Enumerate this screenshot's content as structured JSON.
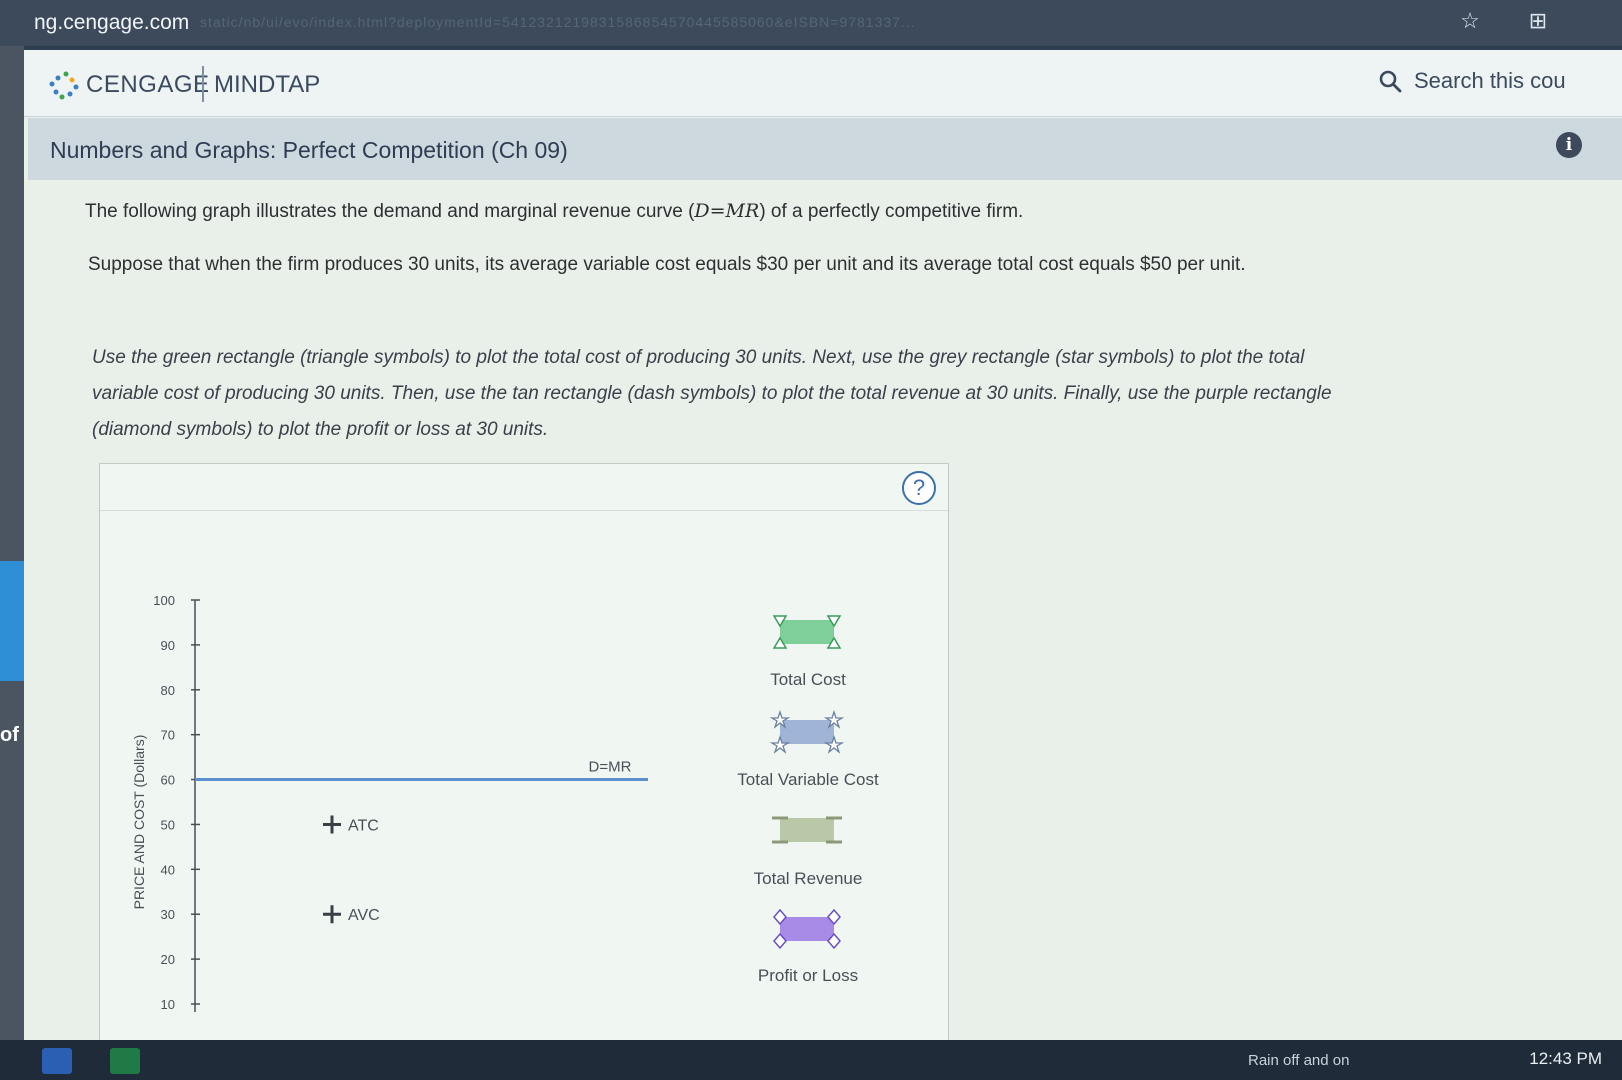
{
  "browser": {
    "url": "ng.cengage.com",
    "url_rest": "static/nb/ui/evo/index.html?deploymentId=5412321219831586854570445585060&eISBN=9781337..."
  },
  "desktop": {
    "left_label": "of"
  },
  "header": {
    "brand": "CENGAGE",
    "product": "MINDTAP",
    "search_placeholder": "Search this cou"
  },
  "activity": {
    "title": "Numbers and Graphs: Perfect Competition (Ch 09)"
  },
  "question": {
    "line1_pre": "The following graph illustrates the demand and marginal revenue curve (",
    "line1_math": "D=MR",
    "line1_post": ") of a perfectly competitive firm.",
    "line2": "Suppose that when the firm produces 30 units, its average variable cost equals $30 per unit and its average total cost equals $50 per unit.",
    "instruction_1": "Use the green rectangle (triangle symbols) to plot the total cost of producing 30 units. Next, use the grey rectangle (star symbols) to plot the total",
    "instruction_2": "variable cost of producing 30 units. Then, use the tan rectangle (dash symbols) to plot the total revenue at 30 units. Finally, use the purple rectangle",
    "instruction_3": "(diamond symbols) to plot the profit or loss at 30 units."
  },
  "graph_panel": {
    "help_label": "?",
    "legend": [
      {
        "label": "Total Cost",
        "symbol": "triangle",
        "color": "#7fcf9a"
      },
      {
        "label": "Total Variable Cost",
        "symbol": "star",
        "color": "#9fb4d6"
      },
      {
        "label": "Total Revenue",
        "symbol": "dash",
        "color": "#b9c9a8"
      },
      {
        "label": "Profit or Loss",
        "symbol": "diamond",
        "color": "#a78be6"
      }
    ]
  },
  "chart_data": {
    "type": "line",
    "ylabel": "PRICE AND COST (Dollars)",
    "ylim": [
      10,
      100
    ],
    "y_ticks": [
      100,
      90,
      80,
      70,
      60,
      50,
      40,
      30,
      20,
      10
    ],
    "series": [
      {
        "name": "D=MR",
        "y": 60,
        "color": "#5b8fcf"
      }
    ],
    "points": [
      {
        "name": "ATC",
        "y": 50
      },
      {
        "name": "AVC",
        "y": 30
      }
    ]
  },
  "taskbar": {
    "clock": "12:43 PM",
    "weather": "Rain off and on"
  }
}
